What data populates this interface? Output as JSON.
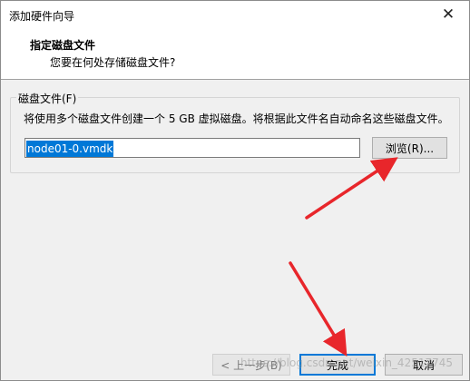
{
  "window": {
    "title": "添加硬件向导",
    "close_glyph": "✕"
  },
  "header": {
    "title": "指定磁盘文件",
    "subtitle": "您要在何处存储磁盘文件?"
  },
  "disk_file_group": {
    "legend": "磁盘文件(F)",
    "description": "将使用多个磁盘文件创建一个 5 GB 虚拟磁盘。将根据此文件名自动命名这些磁盘文件。",
    "file_name_value": "node01-0.vmdk",
    "browse_label": "浏览(R)..."
  },
  "footer": {
    "prev_label": "< 上一步(B)",
    "finish_label": "完成",
    "cancel_label": "取消"
  },
  "watermark": "https://blog.csdn.net/weixin_42517745",
  "annotation_color": "#e8262b"
}
